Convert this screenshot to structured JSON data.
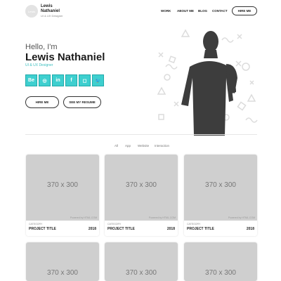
{
  "header": {
    "logo_text": "Lewis",
    "brand_name": "Lewis Nathaniel",
    "brand_sub": "UI & UX Designer",
    "nav": [
      "WORK",
      "ABOUT ME",
      "BLOG",
      "CONTACT"
    ],
    "hire_label": "HIRE ME"
  },
  "hero": {
    "greeting": "Hello, I'm",
    "name": "Lewis Nathaniel",
    "role": "UI & UX Designer",
    "socials": [
      {
        "icon": "behance-icon",
        "glyph": "Be"
      },
      {
        "icon": "dribbble-icon",
        "glyph": "◎"
      },
      {
        "icon": "linkedin-icon",
        "glyph": "in"
      },
      {
        "icon": "facebook-icon",
        "glyph": "f"
      },
      {
        "icon": "instagram-icon",
        "glyph": "◻"
      },
      {
        "icon": "twitter-icon",
        "glyph": "🐦"
      }
    ],
    "hire_label": "HIRE ME",
    "resume_label": "SEE MY RESUME",
    "accent_color": "#3ecfcf"
  },
  "filters": [
    "All",
    "App",
    "Website",
    "Interaction"
  ],
  "projects": [
    {
      "image_label": "370 x 300",
      "powered": "Powered by HTML.COM",
      "category": "CATEGORY",
      "title": "PROJECT TITLE",
      "year": "2018"
    },
    {
      "image_label": "370 x 300",
      "powered": "Powered by HTML.COM",
      "category": "CATEGORY",
      "title": "PROJECT TITLE",
      "year": "2018"
    },
    {
      "image_label": "370 x 300",
      "powered": "Powered by HTML.COM",
      "category": "CATEGORY",
      "title": "PROJECT TITLE",
      "year": "2018"
    },
    {
      "image_label": "370 x 300",
      "powered": "",
      "category": "",
      "title": "",
      "year": ""
    },
    {
      "image_label": "370 x 300",
      "powered": "",
      "category": "",
      "title": "",
      "year": ""
    },
    {
      "image_label": "370 x 300",
      "powered": "",
      "category": "",
      "title": "",
      "year": ""
    }
  ]
}
